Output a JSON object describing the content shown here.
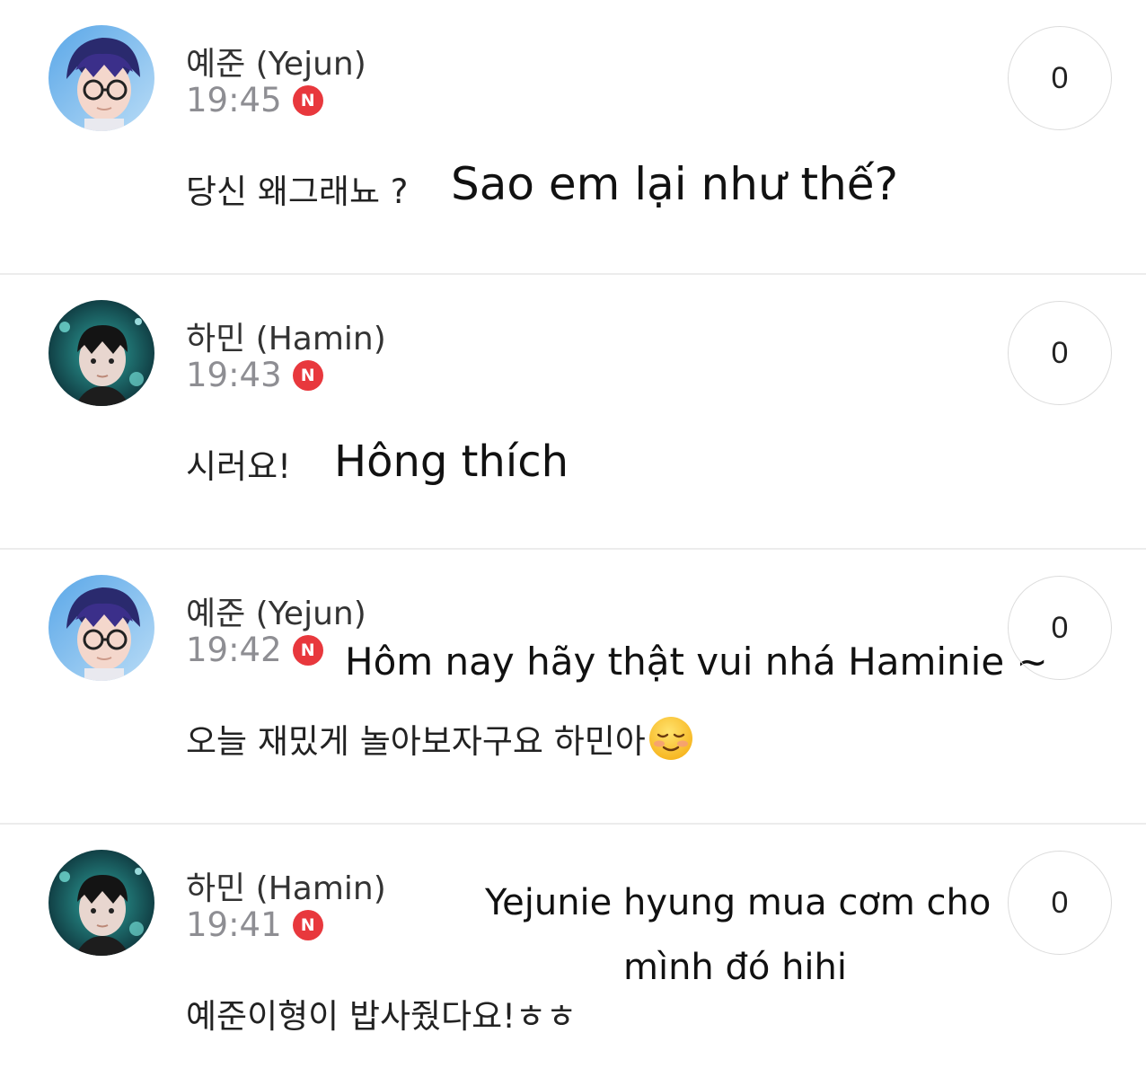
{
  "comments": [
    {
      "author": "예준 (Yejun)",
      "time": "19:45",
      "badge": "N",
      "text": "당신 왜그래뇨 ?",
      "translation": "Sao em lại như thế?",
      "likes": "0",
      "avatar": "yejun-avatar"
    },
    {
      "author": "하민 (Hamin)",
      "time": "19:43",
      "badge": "N",
      "text": "시러요!",
      "translation": "Hông thích",
      "likes": "0",
      "avatar": "hamin-avatar"
    },
    {
      "author": "예준 (Yejun)",
      "time": "19:42",
      "badge": "N",
      "text": "오늘 재밌게 놀아보자구요 하민아",
      "emoji": "smiling-face-emoji",
      "translation": "Hôm nay hãy thật vui nhá Haminie ~",
      "likes": "0",
      "avatar": "yejun-avatar"
    },
    {
      "author": "하민 (Hamin)",
      "time": "19:41",
      "badge": "N",
      "text": "예준이형이 밥사줬다요!ㅎㅎ",
      "translation_line1": "Yejunie hyung mua cơm cho",
      "translation_line2": "mình đó hihi",
      "likes": "0",
      "avatar": "hamin-avatar"
    }
  ],
  "colors": {
    "badge_red": "#e8383d",
    "time_gray": "#8e8e93",
    "divider": "#ececec"
  }
}
